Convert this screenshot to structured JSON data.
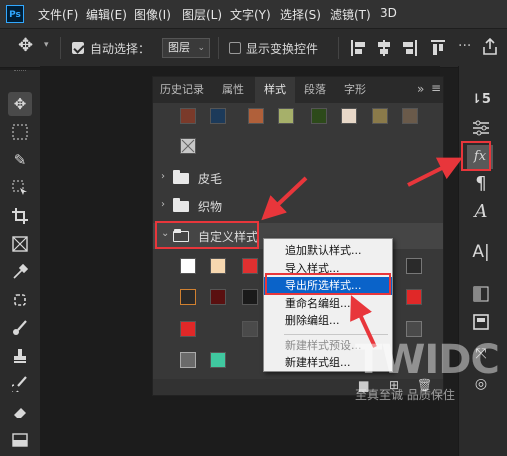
{
  "app": {
    "logo": "Ps"
  },
  "menubar": {
    "items": [
      "文件(F)",
      "编辑(E)",
      "图像(I)",
      "图层(L)",
      "文字(Y)",
      "选择(S)",
      "滤镜(T)",
      "3D"
    ]
  },
  "options": {
    "auto_select_label": "自动选择：",
    "auto_select_checked": true,
    "layer_select_value": "图层",
    "show_transform_label": "显示变换控件",
    "show_transform_checked": false
  },
  "panel": {
    "tabs": [
      "历史记录",
      "属性",
      "样式",
      "段落",
      "字形"
    ],
    "active_tab": "样式",
    "folders": [
      {
        "label": "皮毛",
        "expanded": false
      },
      {
        "label": "织物",
        "expanded": false
      },
      {
        "label": "自定义样式",
        "expanded": true
      }
    ]
  },
  "context_menu": {
    "items": [
      {
        "label": "追加默认样式...",
        "state": "normal"
      },
      {
        "label": "导入样式...",
        "state": "normal"
      },
      {
        "label": "导出所选样式...",
        "state": "highlighted"
      },
      {
        "label": "重命名编组...",
        "state": "normal"
      },
      {
        "label": "删除编组...",
        "state": "normal"
      },
      {
        "label": "新建样式预设...",
        "state": "disabled"
      },
      {
        "label": "新建样式组...",
        "state": "normal"
      }
    ]
  },
  "watermark": {
    "logo_text": "TWIDC",
    "slogan": "至真至诚 品质保住"
  },
  "colors": {
    "annotation_red": "#e8363b",
    "highlight_blue": "#0a63c9",
    "ps_brand_blue": "#31a8ff"
  }
}
